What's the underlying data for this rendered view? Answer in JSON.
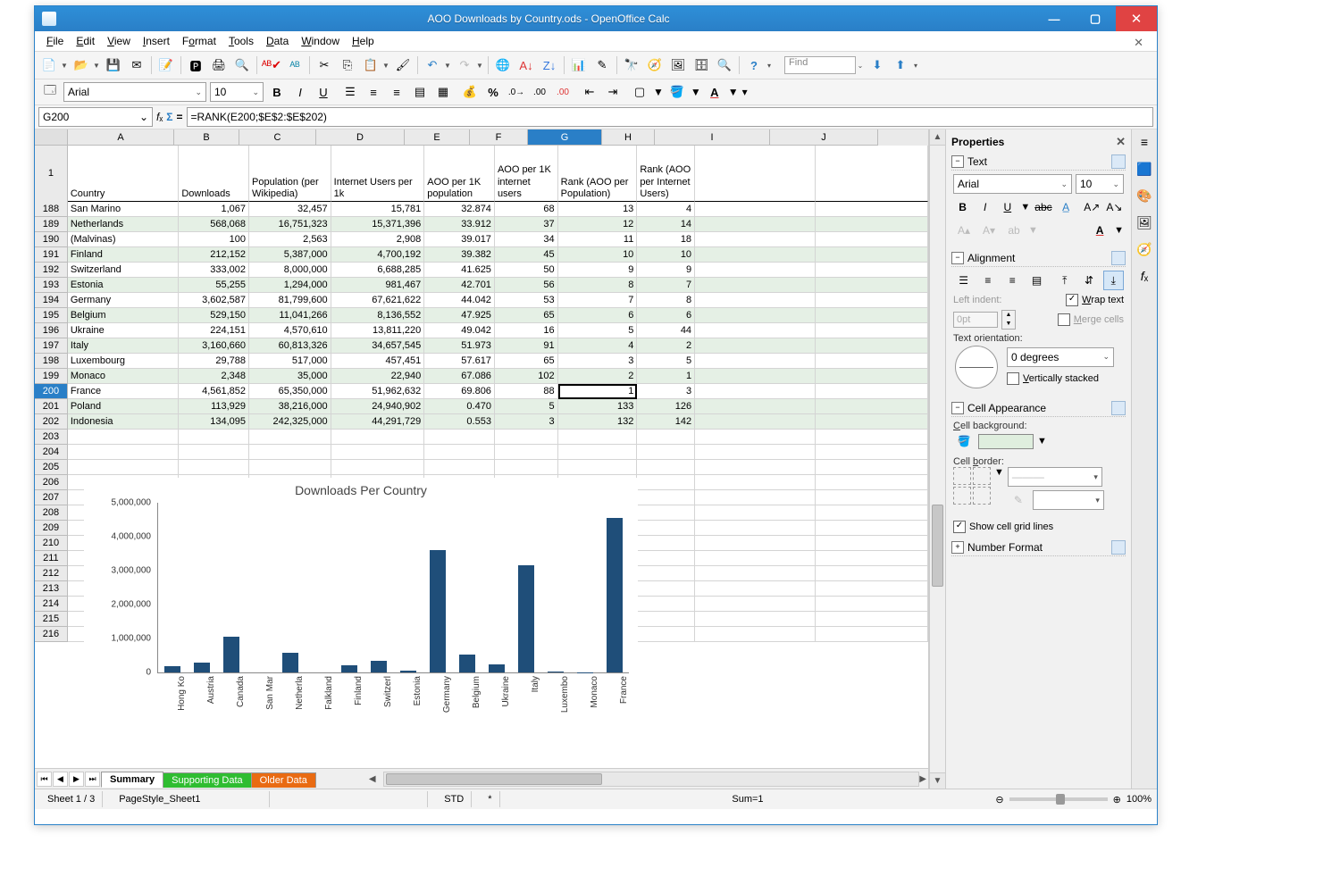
{
  "window": {
    "title": "AOO Downloads by Country.ods - OpenOffice Calc"
  },
  "menu": [
    "File",
    "Edit",
    "View",
    "Insert",
    "Format",
    "Tools",
    "Data",
    "Window",
    "Help"
  ],
  "find_placeholder": "Find",
  "font": {
    "name": "Arial",
    "size": "10"
  },
  "cellref": "G200",
  "formula": "=RANK(E200;$E$2:$E$202)",
  "columns": [
    "A",
    "B",
    "C",
    "D",
    "E",
    "F",
    "G",
    "H",
    "I",
    "J"
  ],
  "activeCol": "G",
  "headerRow": {
    "num": "1",
    "A": "Country",
    "B": "Downloads",
    "C": "Population (per Wikipedia)",
    "D": "Internet Users per 1k",
    "E": "AOO per 1K population",
    "F": "AOO per 1K internet users",
    "G": "Rank (AOO per Population)",
    "H": "Rank (AOO per Internet Users)"
  },
  "rows": [
    {
      "n": "188",
      "even": false,
      "A": "San Marino",
      "B": "1,067",
      "C": "32,457",
      "D": "15,781",
      "E": "32.874",
      "F": "68",
      "G": "13",
      "H": "4"
    },
    {
      "n": "189",
      "even": true,
      "A": "Netherlands",
      "B": "568,068",
      "C": "16,751,323",
      "D": "15,371,396",
      "E": "33.912",
      "F": "37",
      "G": "12",
      "H": "14"
    },
    {
      "n": "190",
      "even": false,
      "A": "(Malvinas)",
      "B": "100",
      "C": "2,563",
      "D": "2,908",
      "E": "39.017",
      "F": "34",
      "G": "11",
      "H": "18"
    },
    {
      "n": "191",
      "even": true,
      "A": "Finland",
      "B": "212,152",
      "C": "5,387,000",
      "D": "4,700,192",
      "E": "39.382",
      "F": "45",
      "G": "10",
      "H": "10"
    },
    {
      "n": "192",
      "even": false,
      "A": "Switzerland",
      "B": "333,002",
      "C": "8,000,000",
      "D": "6,688,285",
      "E": "41.625",
      "F": "50",
      "G": "9",
      "H": "9"
    },
    {
      "n": "193",
      "even": true,
      "A": "Estonia",
      "B": "55,255",
      "C": "1,294,000",
      "D": "981,467",
      "E": "42.701",
      "F": "56",
      "G": "8",
      "H": "7"
    },
    {
      "n": "194",
      "even": false,
      "A": "Germany",
      "B": "3,602,587",
      "C": "81,799,600",
      "D": "67,621,622",
      "E": "44.042",
      "F": "53",
      "G": "7",
      "H": "8"
    },
    {
      "n": "195",
      "even": true,
      "A": "Belgium",
      "B": "529,150",
      "C": "11,041,266",
      "D": "8,136,552",
      "E": "47.925",
      "F": "65",
      "G": "6",
      "H": "6"
    },
    {
      "n": "196",
      "even": false,
      "A": "Ukraine",
      "B": "224,151",
      "C": "4,570,610",
      "D": "13,811,220",
      "E": "49.042",
      "F": "16",
      "G": "5",
      "H": "44"
    },
    {
      "n": "197",
      "even": true,
      "A": "Italy",
      "B": "3,160,660",
      "C": "60,813,326",
      "D": "34,657,545",
      "E": "51.973",
      "F": "91",
      "G": "4",
      "H": "2"
    },
    {
      "n": "198",
      "even": false,
      "A": "Luxembourg",
      "B": "29,788",
      "C": "517,000",
      "D": "457,451",
      "E": "57.617",
      "F": "65",
      "G": "3",
      "H": "5"
    },
    {
      "n": "199",
      "even": true,
      "A": "Monaco",
      "B": "2,348",
      "C": "35,000",
      "D": "22,940",
      "E": "67.086",
      "F": "102",
      "G": "2",
      "H": "1"
    },
    {
      "n": "200",
      "even": false,
      "sel": true,
      "A": "France",
      "B": "4,561,852",
      "C": "65,350,000",
      "D": "51,962,632",
      "E": "69.806",
      "F": "88",
      "G": "1",
      "H": "3"
    },
    {
      "n": "201",
      "even": true,
      "A": "Poland",
      "B": "113,929",
      "C": "38,216,000",
      "D": "24,940,902",
      "E": "0.470",
      "F": "5",
      "G": "133",
      "H": "126"
    },
    {
      "n": "202",
      "even": true,
      "A": "Indonesia",
      "B": "134,095",
      "C": "242,325,000",
      "D": "44,291,729",
      "E": "0.553",
      "F": "3",
      "G": "132",
      "H": "142"
    },
    {
      "n": "203"
    },
    {
      "n": "204"
    },
    {
      "n": "205"
    },
    {
      "n": "206"
    },
    {
      "n": "207"
    },
    {
      "n": "208"
    },
    {
      "n": "209"
    },
    {
      "n": "210"
    },
    {
      "n": "211"
    },
    {
      "n": "212"
    },
    {
      "n": "213"
    },
    {
      "n": "214"
    },
    {
      "n": "215"
    },
    {
      "n": "216"
    }
  ],
  "tabs": {
    "summary": "Summary",
    "supporting": "Supporting Data",
    "older": "Older Data"
  },
  "statusbar": {
    "sheet": "Sheet 1 / 3",
    "pagestyle": "PageStyle_Sheet1",
    "mode": "STD",
    "insert": "*",
    "sum": "Sum=1",
    "zoom": "100%"
  },
  "sidebar": {
    "title": "Properties",
    "text": "Text",
    "align": "Alignment",
    "cellapp": "Cell Appearance",
    "numfmt": "Number Format",
    "font": "Arial",
    "size": "10",
    "leftindent_label": "Left indent:",
    "leftindent_value": "0pt",
    "wrap": "Wrap text",
    "merge": "Merge cells",
    "orient_label": "Text orientation:",
    "orient_value": "0 degrees",
    "vstack": "Vertically stacked",
    "cellbg_label": "Cell background:",
    "cellborder_label": "Cell border:",
    "gridlines": "Show cell grid lines"
  },
  "chart_data": {
    "type": "bar",
    "title": "Downloads Per Country",
    "ylabel": "",
    "xlabel": "",
    "ylim": [
      0,
      5000000
    ],
    "yticks": [
      "5,000,000",
      "4,000,000",
      "3,000,000",
      "2,000,000",
      "1,000,000",
      "0"
    ],
    "categories": [
      "Hong Ko",
      "Austria",
      "Canada",
      "San Mar",
      "Netherla",
      "Falkland",
      "Finland",
      "Switzerl",
      "Estonia",
      "Germany",
      "Belgium",
      "Ukraine",
      "Italy",
      "Luxembo",
      "Monaco",
      "France"
    ],
    "values": [
      180000,
      280000,
      1050000,
      1067,
      568068,
      100,
      212152,
      333002,
      55255,
      3602587,
      529150,
      224151,
      3160660,
      29788,
      2348,
      4561852
    ]
  }
}
